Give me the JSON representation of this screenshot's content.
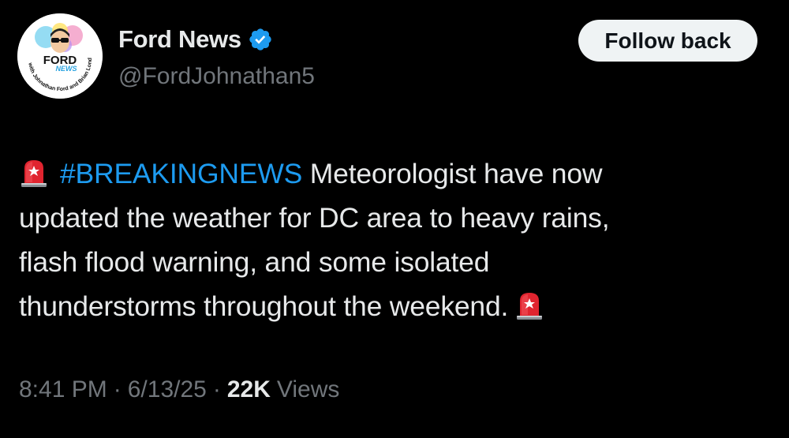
{
  "author": {
    "display_name": "Ford News",
    "handle": "@FordJohnathan5",
    "avatar": {
      "logo_text": "FORD",
      "logo_sub_text": "NEWS",
      "ring_text": "with Johnathan Ford and Brian London"
    },
    "verified": true,
    "verified_color": "#1d9bf0"
  },
  "actions": {
    "follow_label": "Follow back"
  },
  "tweet": {
    "hashtag": "#BREAKINGNEWS",
    "line1_rest": " Meteorologist have now",
    "line2": "updated the weather for DC area to heavy rains,",
    "line3": "flash flood warning, and some isolated",
    "line4": "thunderstorms throughout the weekend.",
    "emoji_icon": "police-car-light-icon"
  },
  "meta": {
    "time": "8:41 PM",
    "separator": "·",
    "date": "6/13/25",
    "views_count": "22K",
    "views_label": "Views"
  },
  "colors": {
    "background": "#000000",
    "text_primary": "#e7e9ea",
    "text_secondary": "#71767b",
    "link": "#1d9bf0",
    "button_bg": "#eff3f4",
    "button_text": "#0f1419"
  }
}
